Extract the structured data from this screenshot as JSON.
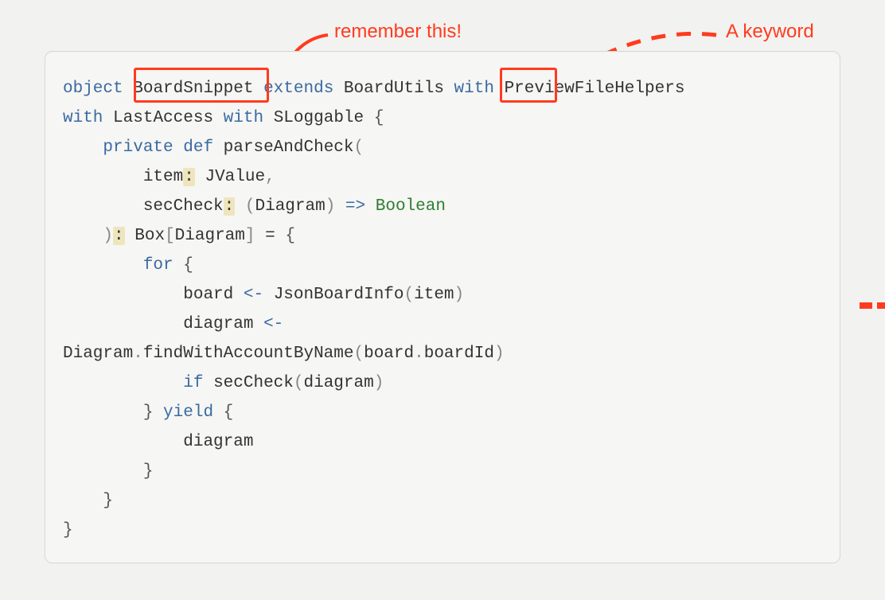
{
  "annotations": {
    "remember": "remember this!",
    "keyword": "A keyword"
  },
  "code": {
    "tokens": {
      "object": "object",
      "BoardSnippet": "BoardSnippet",
      "extends": "extends",
      "BoardUtils": "BoardUtils",
      "with1": "with",
      "PreviewFileHelpers": "PreviewFileHelpers",
      "with2": "with",
      "LastAccess": "LastAccess",
      "with3": "with",
      "SLoggable": "SLoggable",
      "openBrace1": "{",
      "private": "private",
      "def": "def",
      "parseAndCheck": "parseAndCheck",
      "open1": "(",
      "item": "item",
      "colon1": ":",
      "JValue": "JValue",
      "comma1": ",",
      "secCheck": "secCheck",
      "colon2": ":",
      "open2": "(",
      "DiagramT1": "Diagram",
      "close2": ")",
      "arrowT": "=>",
      "Boolean": "Boolean",
      "close1": ")",
      "colon3": ":",
      "Box": "Box",
      "openBr": "[",
      "DiagramT2": "Diagram",
      "closeBr": "]",
      "eq": "=",
      "openBrace2": "{",
      "for": "for",
      "openBrace3": "{",
      "board": "board",
      "leftArrow1": "<-",
      "JsonBoardInfo": "JsonBoardInfo",
      "open3": "(",
      "itemArg": "item",
      "close3": ")",
      "diagramVar": "diagram",
      "leftArrow2": "<-",
      "DiagramObj": "Diagram",
      "dot1": ".",
      "findWithAccountByName": "findWithAccountByName",
      "open4": "(",
      "boardArg": "board",
      "dot2": ".",
      "boardId": "boardId",
      "close4": ")",
      "if": "if",
      "secCheckCall": "secCheck",
      "open5": "(",
      "diagramArg": "diagram",
      "close5": ")",
      "closeBrace3": "}",
      "yield": "yield",
      "openBrace4": "{",
      "diagramRet": "diagram",
      "closeBrace4": "}",
      "closeBrace2": "}",
      "closeBrace1": "}"
    }
  }
}
